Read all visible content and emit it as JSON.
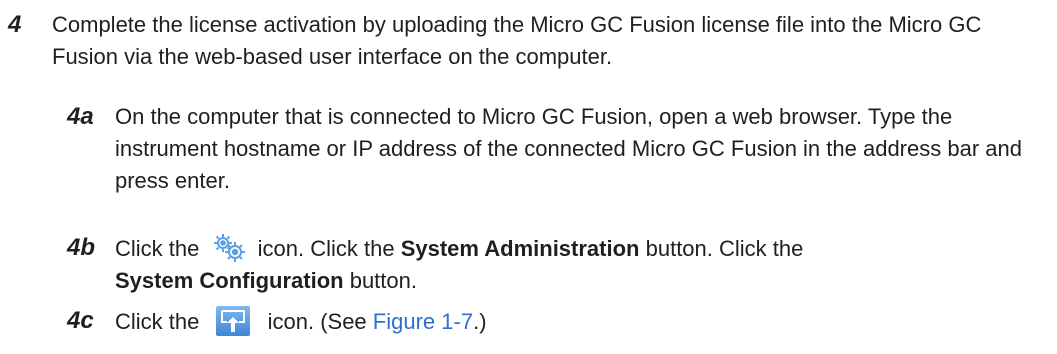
{
  "step": {
    "number": "4",
    "text": "Complete the license activation by uploading the Micro GC Fusion license file into the Micro GC Fusion via the web-based user interface on the computer."
  },
  "substeps": {
    "a": {
      "number": "4a",
      "text": "On the computer that is connected to Micro GC Fusion, open a web browser. Type the instrument hostname or IP address of the connected Micro GC Fusion in the address bar and press enter."
    },
    "b": {
      "number": "4b",
      "part1": "Click the",
      "part2": "icon. Click the",
      "bold1": "System Administration",
      "part3": "button. Click the",
      "bold2": "System Configuration",
      "part4": "button."
    },
    "c": {
      "number": "4c",
      "part1": "Click the",
      "part2": "icon. (See",
      "link": "Figure 1-7",
      "part3": ".)"
    }
  },
  "icons": {
    "gear": "gear-icon",
    "upload": "upload-icon"
  },
  "colors": {
    "text": "#1f1f1f",
    "link": "#2f6fd0",
    "icon_blue": "#5aa0e6"
  }
}
